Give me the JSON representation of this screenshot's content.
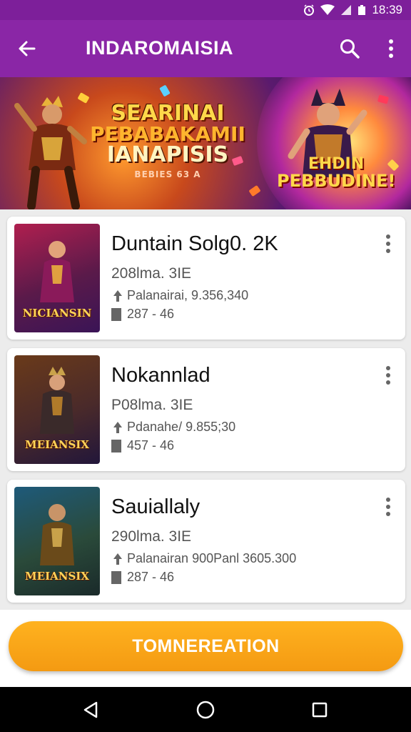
{
  "status_bar": {
    "time": "18:39",
    "icons": [
      "alarm-icon",
      "wifi-icon",
      "signal-icon",
      "battery-icon"
    ]
  },
  "app_bar": {
    "title": "INDAROMAISIA",
    "icons": [
      "back-arrow-icon",
      "search-icon",
      "more-vert-icon"
    ]
  },
  "banner": {
    "headline_1": "SEARINAI",
    "headline_2": "PEBABAKAMII",
    "headline_3": "IANAPISIS",
    "tagline": "BEBIES 63 A",
    "promo_1": "EHDIN",
    "promo_2": "PEBBUDINE!"
  },
  "games": [
    {
      "title": "Duntain Solg0. 2K",
      "subtitle": "208lma. 3IE",
      "meta_1": "Palanairai, 9.356,340",
      "meta_2": "287 - 46",
      "thumb_label": "NICIANSIN",
      "thumb_colors": [
        "#b01f4f",
        "#3a1456"
      ]
    },
    {
      "title": "Nokannlad",
      "subtitle": "P08lma. 3IE",
      "meta_1": "Pdanahe/ 9.855;30",
      "meta_2": "457 - 46",
      "thumb_label": "MEIANSIX",
      "thumb_colors": [
        "#6a3a1a",
        "#22163a"
      ]
    },
    {
      "title": "Sauiallaly",
      "subtitle": "290lma. 3IE",
      "meta_1": "Palanairan 900Panl 3605.300",
      "meta_2": "287 - 46",
      "thumb_label": "MEIANSIX",
      "thumb_colors": [
        "#1e5a7a",
        "#1a2a2a"
      ]
    }
  ],
  "cta": {
    "label": "TOMNEREATION"
  },
  "nav_bar": {
    "icons": [
      "back-triangle-icon",
      "home-circle-icon",
      "recents-square-icon"
    ]
  },
  "colors": {
    "primary": "#8a26a6",
    "accent": "#f7a516"
  }
}
